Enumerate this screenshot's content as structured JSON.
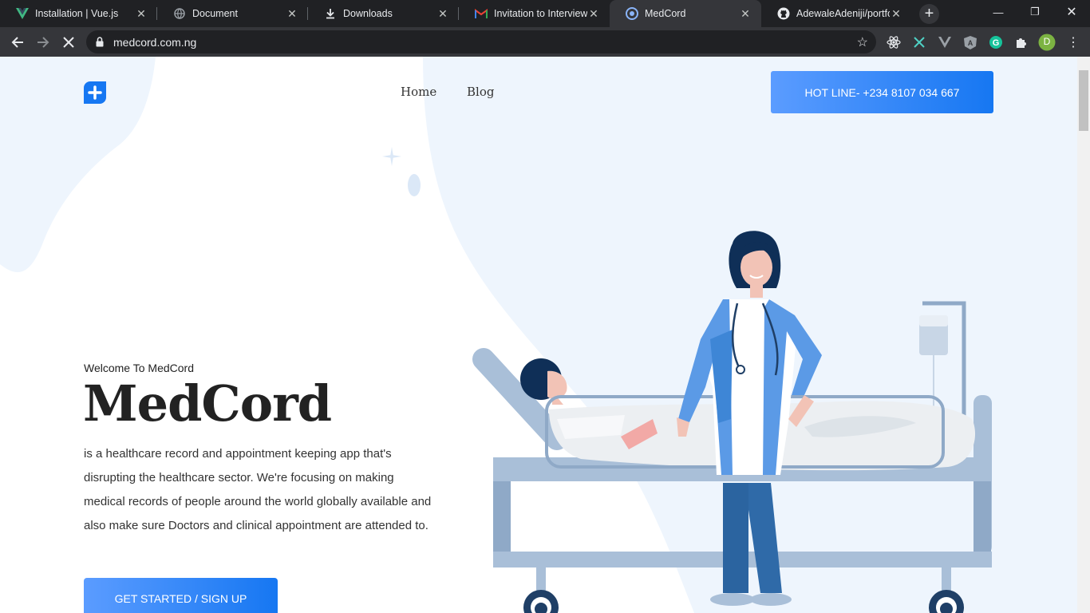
{
  "tabs": [
    {
      "title": "Installation | Vue.js",
      "icon": "vue-icon"
    },
    {
      "title": "Document",
      "icon": "globe-icon"
    },
    {
      "title": "Downloads",
      "icon": "download-icon"
    },
    {
      "title": "Invitation to Interview -",
      "icon": "gmail-icon"
    },
    {
      "title": "MedCord",
      "icon": "medcord-icon",
      "active": true
    },
    {
      "title": "AdewaleAdeniji/portfoli",
      "icon": "github-icon"
    }
  ],
  "browser": {
    "url": "medcord.com.ng",
    "profile_initial": "D"
  },
  "nav": {
    "home": "Home",
    "blog": "Blog",
    "hotline": "HOT LINE- +234 8107 034 667"
  },
  "hero": {
    "welcome": "Welcome To MedCord",
    "title": "MedCord",
    "line1": "is a healthcare record and appointment keeping app that's",
    "line2": "disrupting the healthcare sector. We're focusing on making",
    "line3": "medical records of people around the world globally available and",
    "line4": "also make sure Doctors and clinical appointment are attended to.",
    "cta": "GET STARTED / SIGN UP"
  },
  "colors": {
    "accent": "#1677f2",
    "accent_light": "#5b9cff",
    "page_bg_tint": "#eef5fd"
  }
}
